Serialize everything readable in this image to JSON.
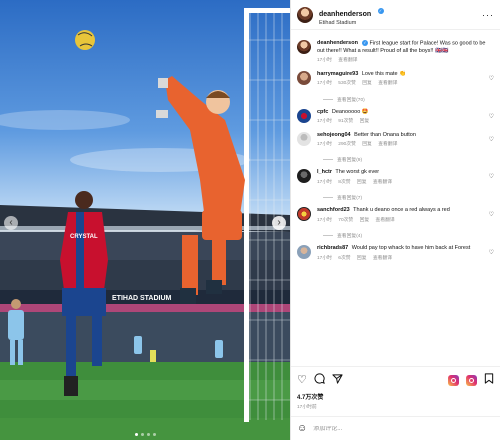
{
  "post": {
    "username": "deanhenderson",
    "location": "Etihad Stadium",
    "caption": "First league start for Palace! Was so good to be out there!! What a result!! Proud of all the boys!! 🇬🇧🇬🇧",
    "caption_time": "17小时",
    "translate": "查看翻译"
  },
  "photo": {
    "board_text": "ETIHAD STADIUM",
    "shirt_text": "CRYSTAL",
    "slide_count": 4,
    "active_slide": 1
  },
  "comments": [
    {
      "user": "harrymaguire93",
      "text": "Love this mate 👏",
      "time": "17小时",
      "likes": "530次赞",
      "reply": "回复",
      "translate": "查看翻译",
      "replies": "查看回复(70)",
      "avatar_color": "#7a4b3a"
    },
    {
      "user": "cpfc",
      "text": "Deanooooo 🤩",
      "time": "17小时",
      "likes": "91次赞",
      "reply": "回复",
      "translate": "",
      "replies": "",
      "avatar_color": "#1b458f"
    },
    {
      "user": "sehojeong04",
      "text": "Better than Onana button",
      "time": "17小时",
      "likes": "290次赞",
      "reply": "回复",
      "translate": "查看翻译",
      "replies": "查看回复(9)",
      "avatar_color": "#d9d9d9"
    },
    {
      "user": "l_hctr",
      "text": "The worst gk ever",
      "time": "17小时",
      "likes": "8次赞",
      "reply": "回复",
      "translate": "查看翻译",
      "replies": "查看回复(7)",
      "avatar_color": "#2a2a2a"
    },
    {
      "user": "sanchford23",
      "text": "Thank u deano once a red always a red",
      "time": "17小时",
      "likes": "70次赞",
      "reply": "回复",
      "translate": "查看翻译",
      "replies": "查看回复(4)",
      "avatar_color": "#c0392b"
    },
    {
      "user": "richbrads87",
      "text": "Would pay top whack to have him back at Forest",
      "time": "17小时",
      "likes": "6次赞",
      "reply": "回复",
      "translate": "查看翻译",
      "replies": "",
      "avatar_color": "#8aa0b8"
    }
  ],
  "actions": {
    "likes": "4.7万次赞",
    "time": "17小时前",
    "comment_placeholder": "添加评论..."
  },
  "icons": {
    "heart": "heart-icon",
    "comment": "comment-icon",
    "share": "share-icon",
    "save": "bookmark-icon",
    "more": "more-icon",
    "emoji": "emoji-icon"
  }
}
